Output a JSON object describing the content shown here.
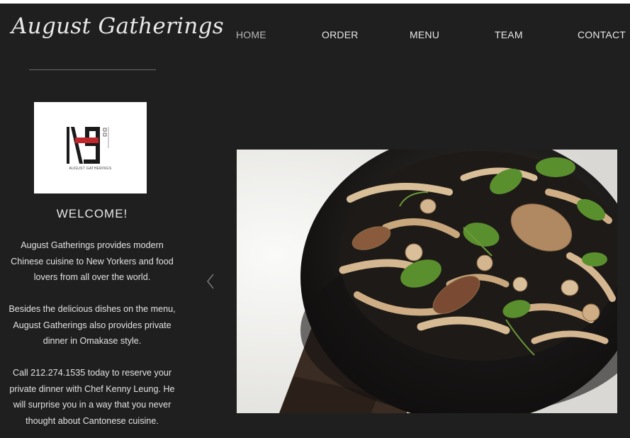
{
  "brand": {
    "name": "August Gatherings"
  },
  "nav": [
    {
      "label": "HOME",
      "active": true
    },
    {
      "label": "ORDER",
      "active": false
    },
    {
      "label": "MENU",
      "active": false
    },
    {
      "label": "TEAM",
      "active": false
    },
    {
      "label": "CONTACT",
      "active": false
    }
  ],
  "logo": {
    "caption": "AUGUST GATHERINGS"
  },
  "welcome": {
    "heading": "WELCOME!",
    "paragraphs": [
      "August Gatherings provides modern Chinese cuisine to New Yorkers and food lovers from all over the world.",
      "Besides the delicious dishes on the menu, August Gatherings also provides private dinner in Omakase style.",
      "Call 212.274.1535 today to reserve your private dinner with Chef Kenny Leung. He will surprise you in a way that you never thought about Cantonese cuisine."
    ]
  },
  "carousel": {
    "prev_icon": "chevron-left-icon"
  },
  "colors": {
    "background": "#1f1f1f",
    "text": "#e6e6e6",
    "logo_accent": "#c0272d"
  }
}
